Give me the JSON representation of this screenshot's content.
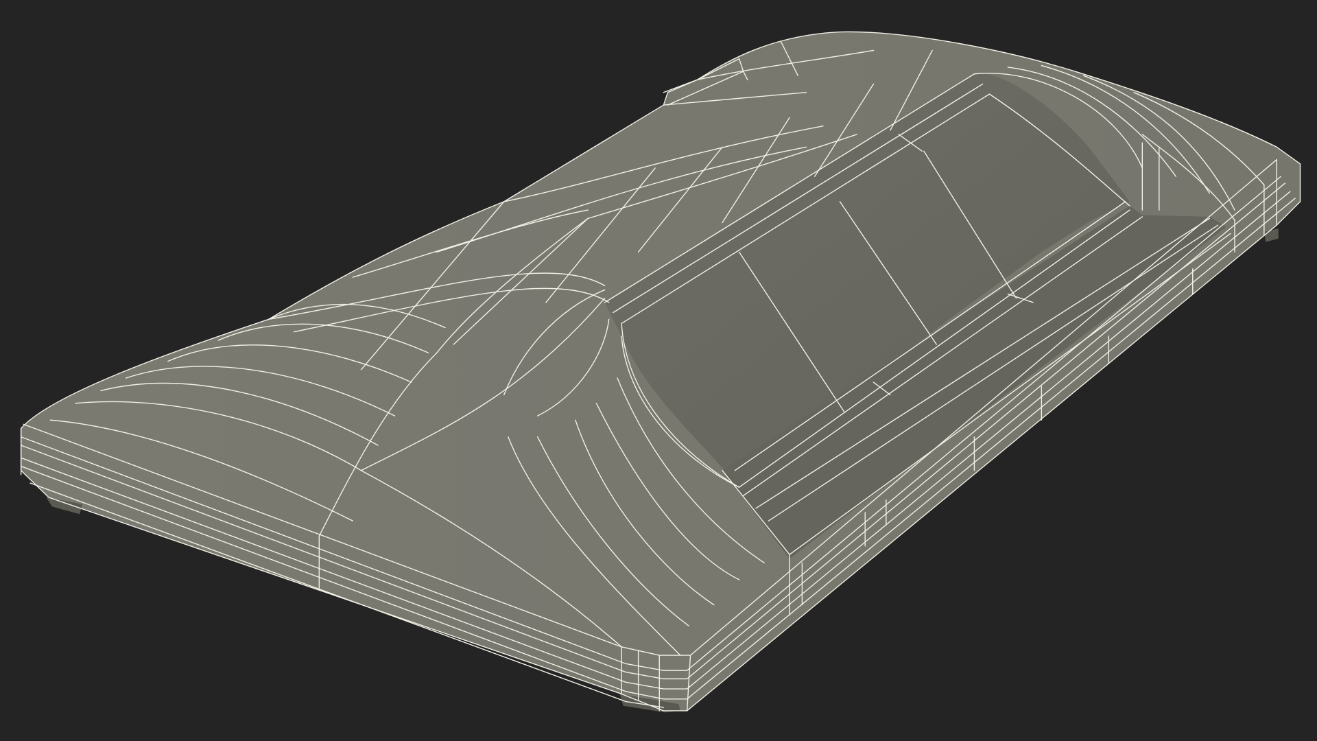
{
  "scene": {
    "background_color": "#242424",
    "surface_color": "#73736a",
    "surface_shadow_color": "#5f5f57",
    "wire_color": "#f2f0e6",
    "render_style": "wireframe-on-shaded"
  }
}
